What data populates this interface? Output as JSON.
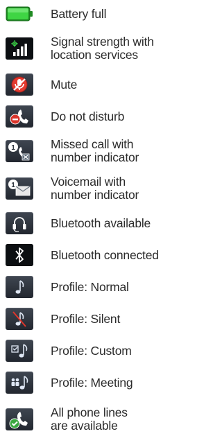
{
  "legend": {
    "items": [
      {
        "icon": "battery-full-icon",
        "label": "Battery full"
      },
      {
        "icon": "signal-location-icon",
        "label": "Signal strength with\nlocation services"
      },
      {
        "icon": "mute-icon",
        "label": "Mute"
      },
      {
        "icon": "do-not-disturb-icon",
        "label": "Do not disturb"
      },
      {
        "icon": "missed-call-icon",
        "label": "Missed call with\nnumber indicator"
      },
      {
        "icon": "voicemail-icon",
        "label": "Voicemail with\nnumber indicator"
      },
      {
        "icon": "bluetooth-available-icon",
        "label": "Bluetooth available"
      },
      {
        "icon": "bluetooth-connected-icon",
        "label": "Bluetooth connected"
      },
      {
        "icon": "profile-normal-icon",
        "label": "Profile: Normal"
      },
      {
        "icon": "profile-silent-icon",
        "label": "Profile: Silent"
      },
      {
        "icon": "profile-custom-icon",
        "label": "Profile: Custom"
      },
      {
        "icon": "profile-meeting-icon",
        "label": "Profile: Meeting"
      },
      {
        "icon": "all-lines-available-icon",
        "label": "All phone lines\nare available"
      }
    ],
    "colors": {
      "battery_green": "#35c83a",
      "mute_red": "#e0352b",
      "dnd_red": "#d9342b",
      "check_green": "#3aa83f"
    }
  }
}
